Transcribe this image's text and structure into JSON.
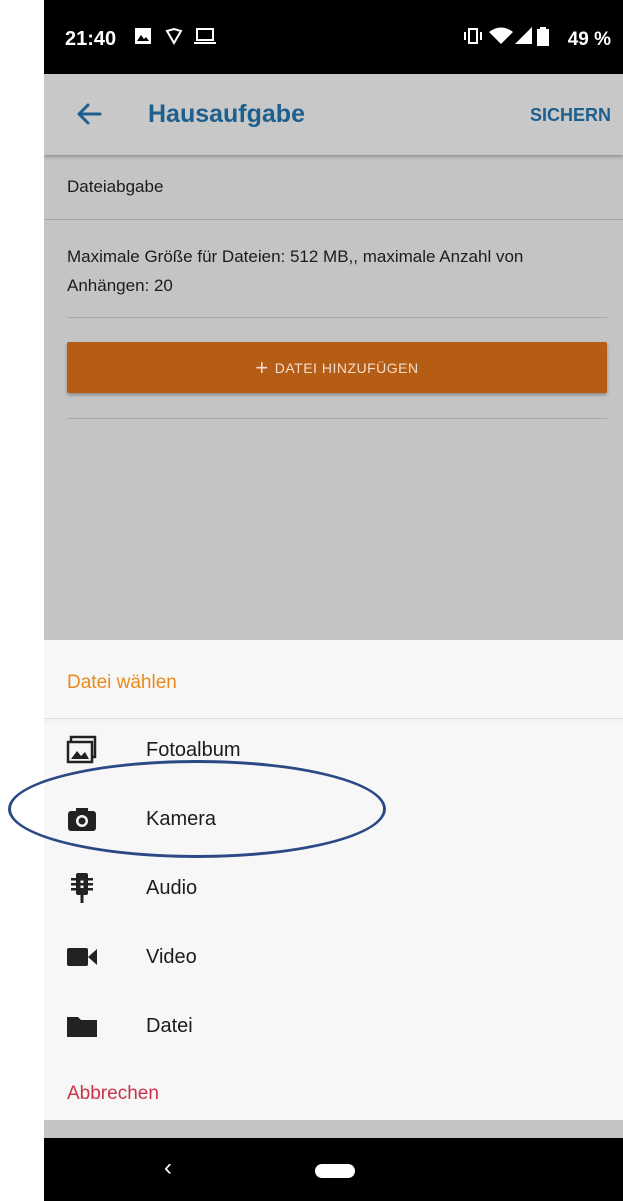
{
  "status_bar": {
    "time": "21:40",
    "battery": "49 %",
    "icons": [
      "image-notification-icon",
      "shield-icon",
      "laptop-icon",
      "vibrate-icon",
      "wifi-icon",
      "signal-icon",
      "battery-icon"
    ]
  },
  "app_bar": {
    "back_icon": "arrow-left-icon",
    "title": "Hausaufgabe",
    "action": "SICHERN"
  },
  "content": {
    "section_title": "Dateiabgabe",
    "limits_text": "Maximale Größe für Dateien: 512 MB,, maximale Anzahl von Anhängen: 20",
    "add_button": {
      "icon": "+",
      "label": "DATEI HINZUFÜGEN"
    }
  },
  "sheet": {
    "title": "Datei wählen",
    "options": [
      {
        "label": "Fotoalbum",
        "icon": "photo-album-icon"
      },
      {
        "label": "Kamera",
        "icon": "camera-icon"
      },
      {
        "label": "Audio",
        "icon": "microphone-icon"
      },
      {
        "label": "Video",
        "icon": "video-camera-icon"
      },
      {
        "label": "Datei",
        "icon": "folder-icon"
      }
    ],
    "cancel": "Abbrechen"
  },
  "nav_bar": {
    "back": "‹"
  },
  "colors": {
    "accent_blue": "#1d5f8e",
    "button_orange": "#b55d14",
    "sheet_title_orange": "#ea8a1b",
    "cancel_red": "#c9334a",
    "highlight_ring": "#2b4a85"
  }
}
